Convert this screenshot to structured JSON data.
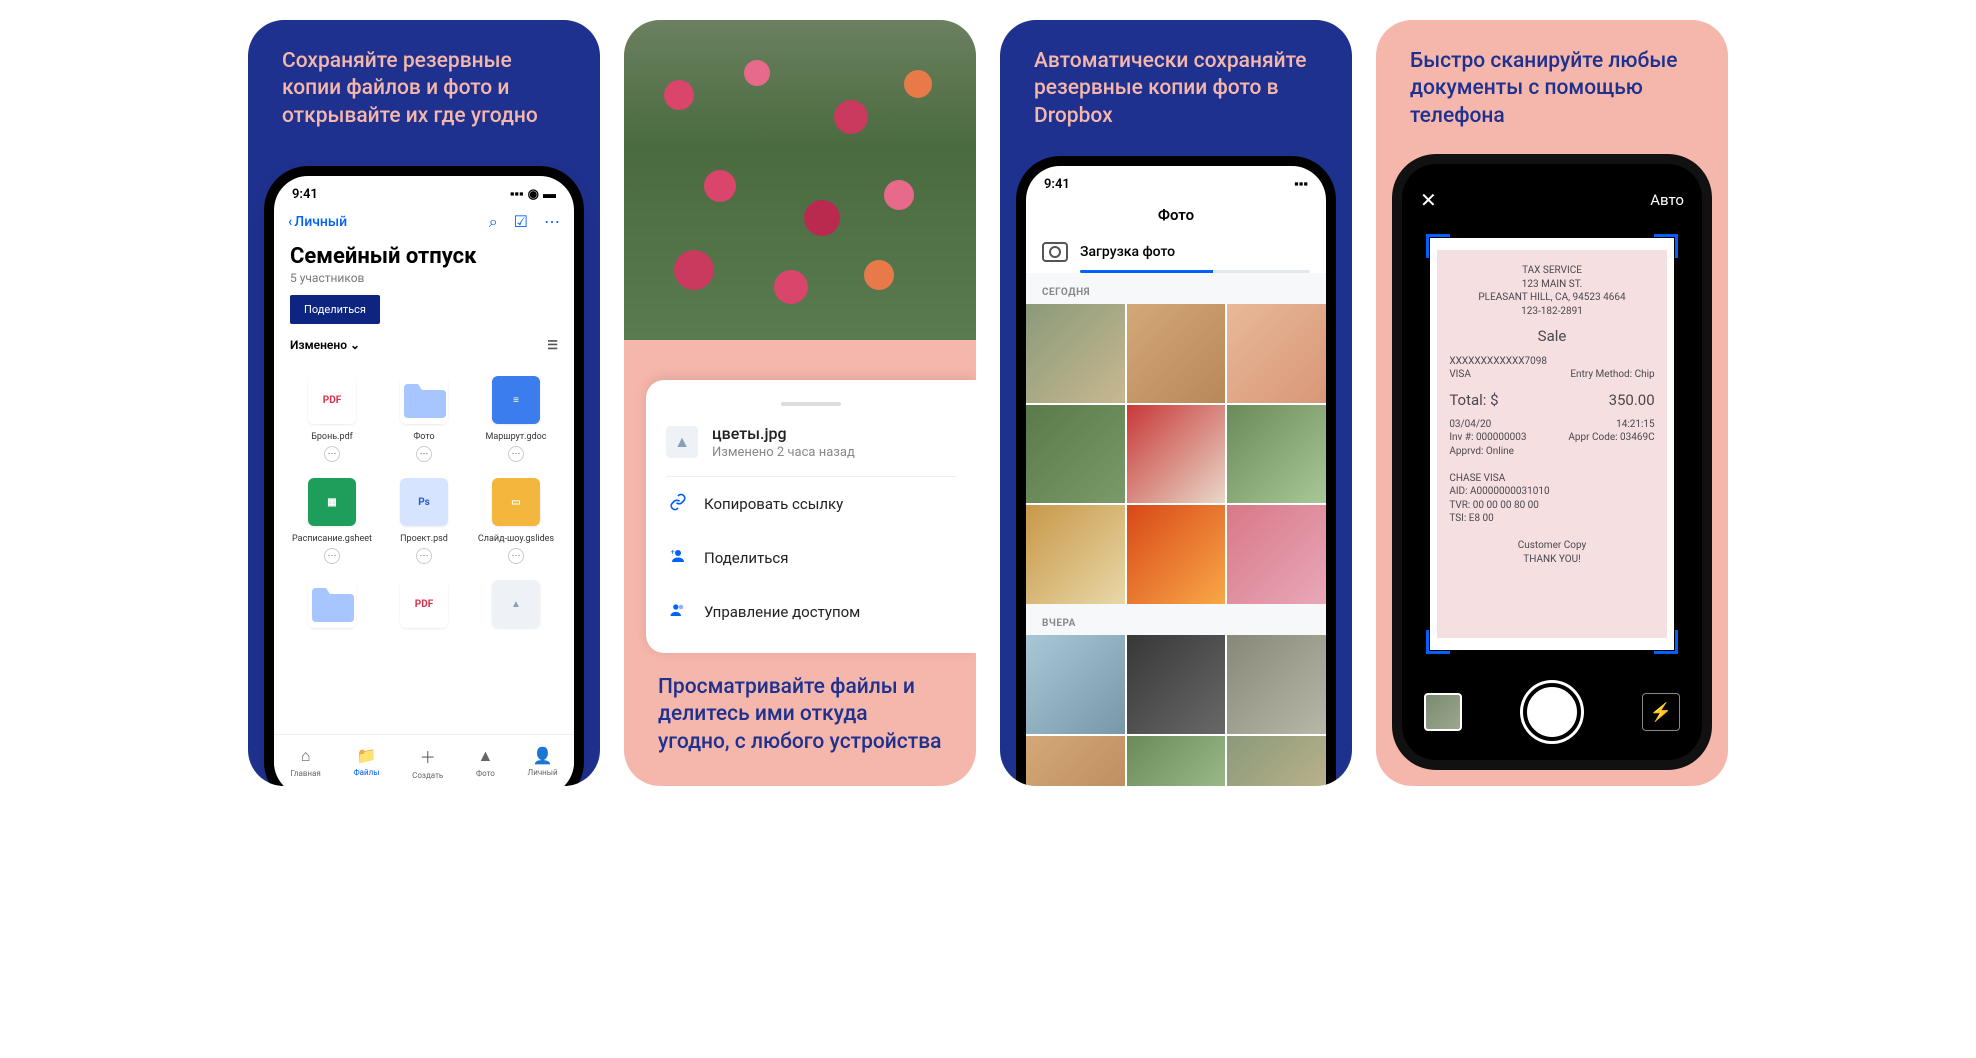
{
  "card1": {
    "caption": "Сохраняйте резервные копии файлов и фото и открывайте их где угодно",
    "status_time": "9:41",
    "back": "Личный",
    "title": "Семейный отпуск",
    "members": "5 участников",
    "share": "Поделиться",
    "sort": "Изменено",
    "files": [
      {
        "name": "Бронь.pdf",
        "badge": "PDF",
        "bg": "#fff",
        "fg": "#d9304c"
      },
      {
        "name": "Фото",
        "badge": "",
        "bg": "#a7c6ff",
        "fg": "#a7c6ff",
        "folder": true
      },
      {
        "name": "Маршрут.gdoc",
        "badge": "≡",
        "bg": "#3b7ded",
        "fg": "#fff"
      },
      {
        "name": "Расписание.gsheet",
        "badge": "▦",
        "bg": "#1e9e5a",
        "fg": "#fff"
      },
      {
        "name": "Проект.psd",
        "badge": "Ps",
        "bg": "#d6e4ff",
        "fg": "#2458d4"
      },
      {
        "name": "Слайд-шоу.gslides",
        "badge": "▭",
        "bg": "#f4b73e",
        "fg": "#fff"
      },
      {
        "name": "",
        "badge": "",
        "bg": "#a7c6ff",
        "fg": "#a7c6ff",
        "folder": true,
        "nomore": true
      },
      {
        "name": "",
        "badge": "PDF",
        "bg": "#fff",
        "fg": "#d9304c",
        "nomore": true
      },
      {
        "name": "",
        "badge": "▲",
        "bg": "#eef2f7",
        "fg": "#8aa0b8",
        "nomore": true
      }
    ],
    "tabs": [
      {
        "label": "Главная",
        "icon": "⌂"
      },
      {
        "label": "Файлы",
        "icon": "📁",
        "active": true
      },
      {
        "label": "Создать",
        "icon": "＋"
      },
      {
        "label": "Фото",
        "icon": "▲"
      },
      {
        "label": "Личный",
        "icon": "👤"
      }
    ]
  },
  "card2": {
    "caption": "Просматривайте файлы и делитесь ими откуда угодно, с любого устройства",
    "file_name": "цветы.jpg",
    "file_sub": "Изменено 2 часа назад",
    "actions": [
      {
        "icon": "🔗",
        "label": "Копировать ссылку"
      },
      {
        "icon": "+👤",
        "label": "Поделиться"
      },
      {
        "icon": "👤⚙",
        "label": "Управление доступом"
      }
    ]
  },
  "card3": {
    "caption": "Автоматически сохраняйте резервные копии фото в Dropbox",
    "status_time": "9:41",
    "title": "Фото",
    "upload": "Загрузка фото",
    "today": "СЕГОДНЯ",
    "yesterday": "ВЧЕРА"
  },
  "card4": {
    "caption": "Быстро сканируйте любые документы с помощью телефона",
    "close": "✕",
    "auto": "Авто",
    "receipt": {
      "h1": "TAX SERVICE",
      "h2": "123 MAIN ST.",
      "h3": "PLEASANT HILL, CA, 94523 4664",
      "h4": "123-182-2891",
      "sale": "Sale",
      "r1a": "XXXXXXXXXXXX7098",
      "r1b": "",
      "r2a": "VISA",
      "r2b": "Entry Method: Chip",
      "r3a": "Total: $",
      "r3b": "350.00",
      "r4a": "03/04/20",
      "r4b": "14:21:15",
      "r5a": "Inv #: 000000003",
      "r5b": "Appr Code: 03469C",
      "r6": "Apprvd: Online",
      "r7": "CHASE VISA",
      "r8": "AID: A0000000031010",
      "r9": "TVR: 00 00 00 80 00",
      "r10": "TSI: E8 00",
      "f1": "Customer Copy",
      "f2": "THANK YOU!"
    }
  }
}
